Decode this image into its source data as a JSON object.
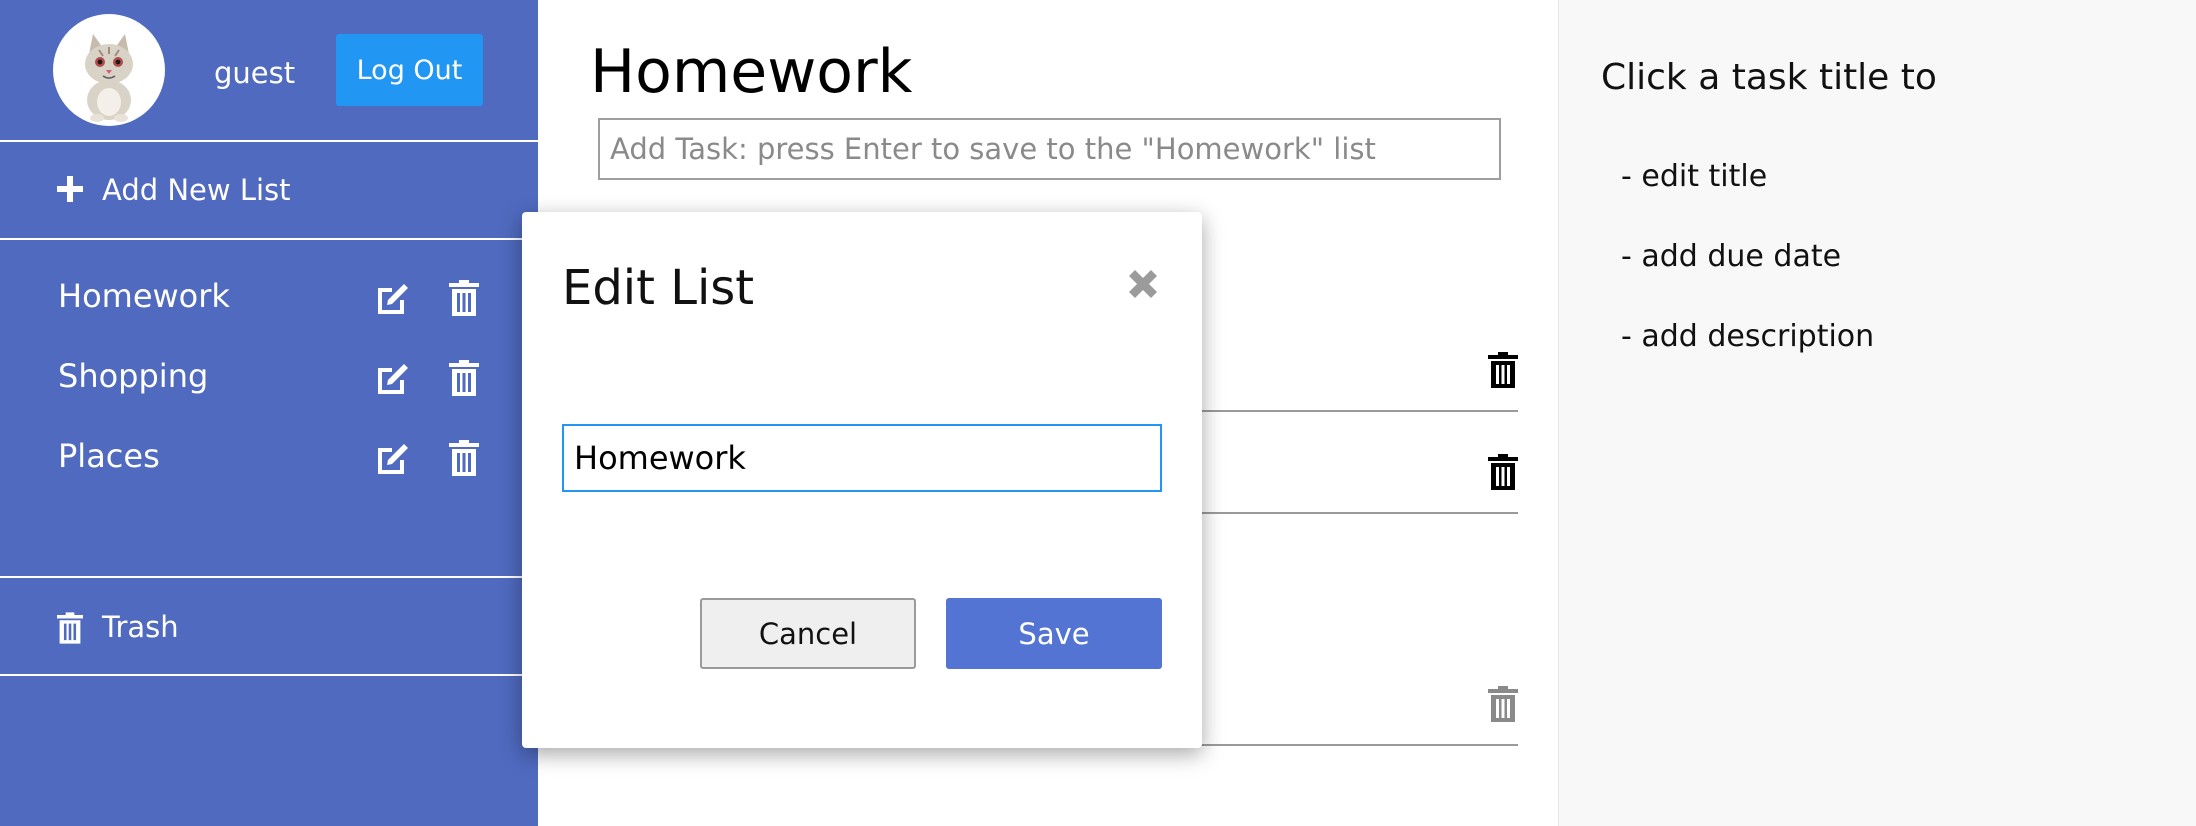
{
  "user": {
    "name": "guest",
    "logout_label": "Log Out",
    "avatar_icon": "cat-avatar-icon"
  },
  "sidebar": {
    "add_list_label": "Add New List",
    "lists": [
      {
        "label": "Homework"
      },
      {
        "label": "Shopping"
      },
      {
        "label": "Places"
      }
    ],
    "trash_label": "Trash"
  },
  "main": {
    "title": "Homework",
    "add_task_placeholder": "Add Task: press Enter to save to the \"Homework\" list"
  },
  "help": {
    "title": "Click a task title to",
    "items": [
      "- edit title",
      "- add due date",
      "- add description"
    ]
  },
  "modal": {
    "title": "Edit List",
    "input_value": "Homework",
    "cancel_label": "Cancel",
    "save_label": "Save"
  },
  "colors": {
    "sidebar_bg": "#4f6abf",
    "logout_bg": "#2196f3",
    "save_bg": "#5474d3",
    "input_focus": "#2196f3"
  }
}
